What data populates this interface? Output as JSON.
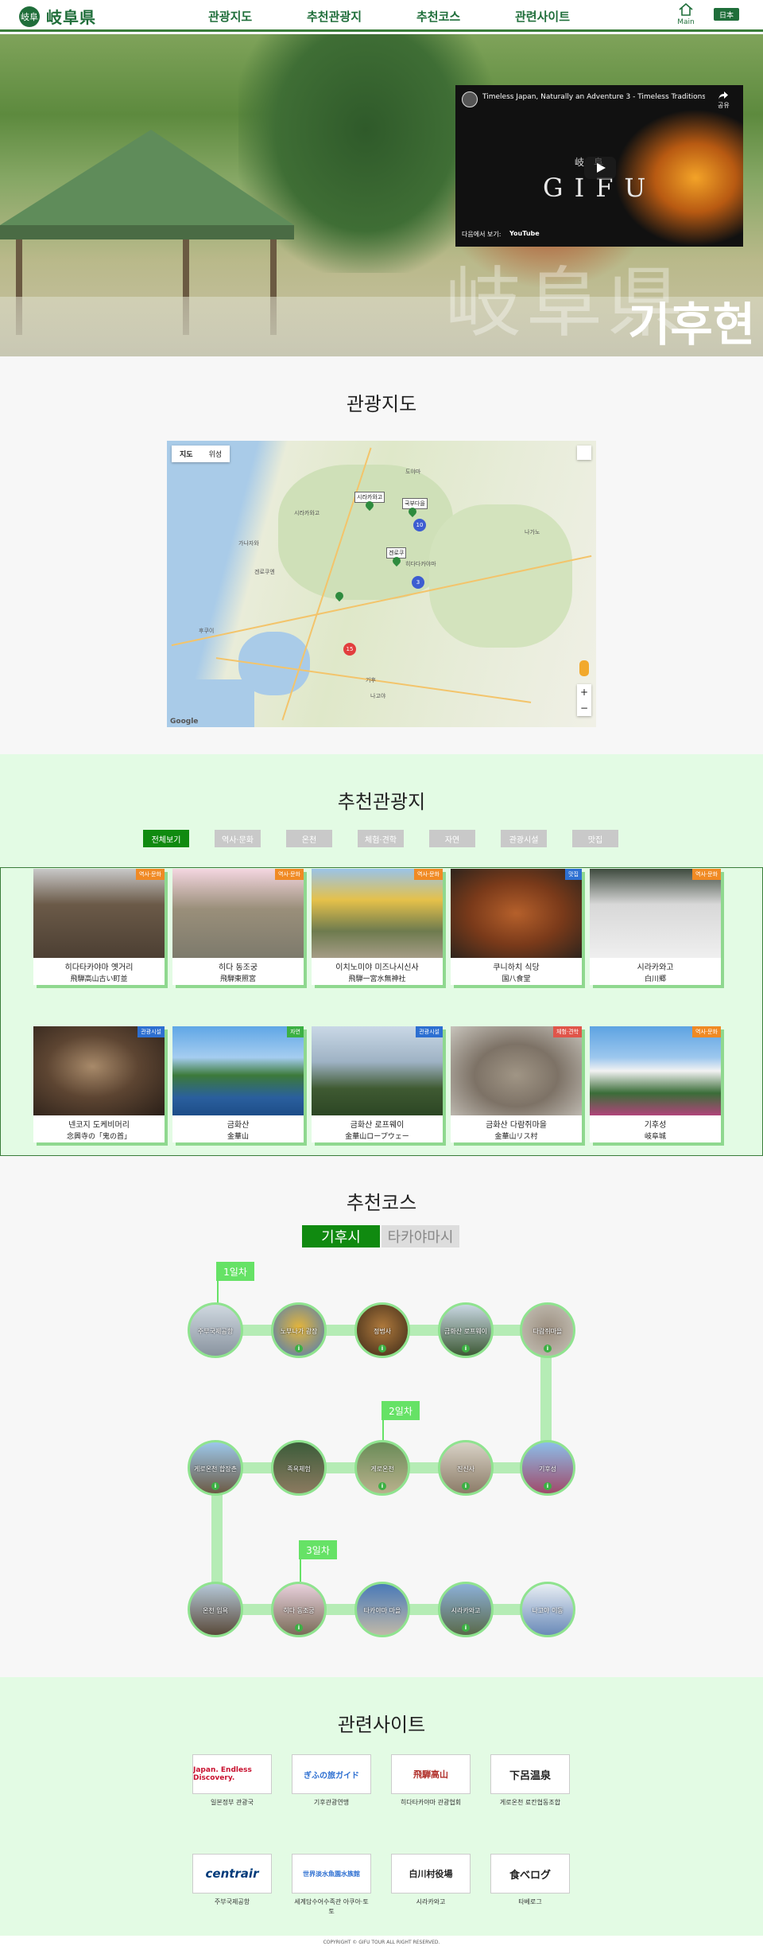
{
  "header": {
    "logo_text": "岐阜県",
    "logo_mark": "岐阜",
    "nav": [
      "관광지도",
      "추천관광지",
      "추천코스",
      "관련사이트"
    ],
    "main_label": "Main",
    "lang_label": "日本"
  },
  "hero": {
    "kanji": "岐阜県",
    "hangul": "기후현",
    "video": {
      "title": "Timeless Japan, Naturally an Adventure 3 - Timeless Traditions | Visit...",
      "share_label": "공유",
      "gifu_jp": "岐　阜",
      "gifu_en": "GIFU",
      "more_label": "다음에서 보기:",
      "youtube_label": "YouTube"
    }
  },
  "map_section": {
    "title": "관광지도",
    "map_types": [
      "지도",
      "위성"
    ],
    "labels": [
      "시라카와고",
      "히다다카야마",
      "겐로쿠엔",
      "도야마",
      "나가노",
      "가나자와",
      "기후",
      "나고야",
      "후쿠이"
    ],
    "marker_labels": [
      "시라카와고",
      "국부다을",
      "겐로쿠"
    ],
    "clusters": [
      "10",
      "3",
      "15"
    ],
    "zoom_plus": "+",
    "zoom_minus": "−",
    "google": "Google"
  },
  "recommend": {
    "title": "추천관광지",
    "filters": [
      "전체보기",
      "역사·문화",
      "온천",
      "체험·견학",
      "자연",
      "관광시설",
      "맛집"
    ],
    "tag_colors": {
      "역사·문화": "#f08a24",
      "맛집": "#2d6fd1",
      "관광시설": "#2d6fd1",
      "자연": "#3cb043",
      "체험·견학": "#e0554a"
    },
    "cards": [
      {
        "name": "히다타카야마 옛거리",
        "jp": "飛騨高山古い町並",
        "tag": "역사·문화"
      },
      {
        "name": "히다 동조궁",
        "jp": "飛騨東照宮",
        "tag": "역사·문화"
      },
      {
        "name": "이치노미야 미즈나시신사",
        "jp": "飛騨一宮水無神社",
        "tag": "역사·문화"
      },
      {
        "name": "쿠니하치 식당",
        "jp": "国八食堂",
        "tag": "맛집"
      },
      {
        "name": "시라카와고",
        "jp": "白川郷",
        "tag": "역사·문화"
      },
      {
        "name": "넨코지 도케비머리",
        "jp": "念興寺の「鬼の首」",
        "tag": "관광시설"
      },
      {
        "name": "금화산",
        "jp": "金華山",
        "tag": "자연"
      },
      {
        "name": "금화산 로프웨이",
        "jp": "金華山ロープウェー",
        "tag": "관광시설"
      },
      {
        "name": "금화산 다람쥐마을",
        "jp": "金華山リス村",
        "tag": "체험·견학"
      },
      {
        "name": "기후성",
        "jp": "岐阜城",
        "tag": "역사·문화"
      }
    ]
  },
  "course": {
    "title": "추천코스",
    "tabs": [
      "기후시",
      "타카야마시"
    ],
    "days": [
      "1일차",
      "2일차",
      "3일차"
    ],
    "info_glyph": "i",
    "row1": [
      "주부국제공항",
      "노부나가 광장",
      "정법사",
      "금화산 로프웨이",
      "다람쥐마을"
    ],
    "row2": [
      "게로온천 합장촌",
      "족욕체험",
      "게로온천",
      "진신사",
      "기후성"
    ],
    "row3": [
      "온천 입욕",
      "히다 동조궁",
      "타카야마 마을",
      "시라카와고",
      "나고야 이동"
    ]
  },
  "related": {
    "title": "관련사이트",
    "sites": [
      {
        "logo": "Japan. Endless Discovery.",
        "caption": "일본정부 관광국"
      },
      {
        "logo": "ぎふの旅ガイド",
        "caption": "기후관광연맹"
      },
      {
        "logo": "飛騨高山",
        "caption": "히다타카야마 관광협회"
      },
      {
        "logo": "下呂温泉",
        "caption": "게로온천 료칸협동조합"
      },
      {
        "logo": "centrair",
        "caption": "주부국제공항"
      },
      {
        "logo": "世界淡水魚園水族館",
        "caption": "세계담수어수족관 아쿠아·토토"
      },
      {
        "logo": "白川村役場",
        "caption": "시라카와고"
      },
      {
        "logo": "食べログ",
        "caption": "타베로그"
      }
    ]
  },
  "footer": {
    "copyright": "COPYRIGHT © GIFU TOUR ALL RIGHT RESERVED."
  }
}
